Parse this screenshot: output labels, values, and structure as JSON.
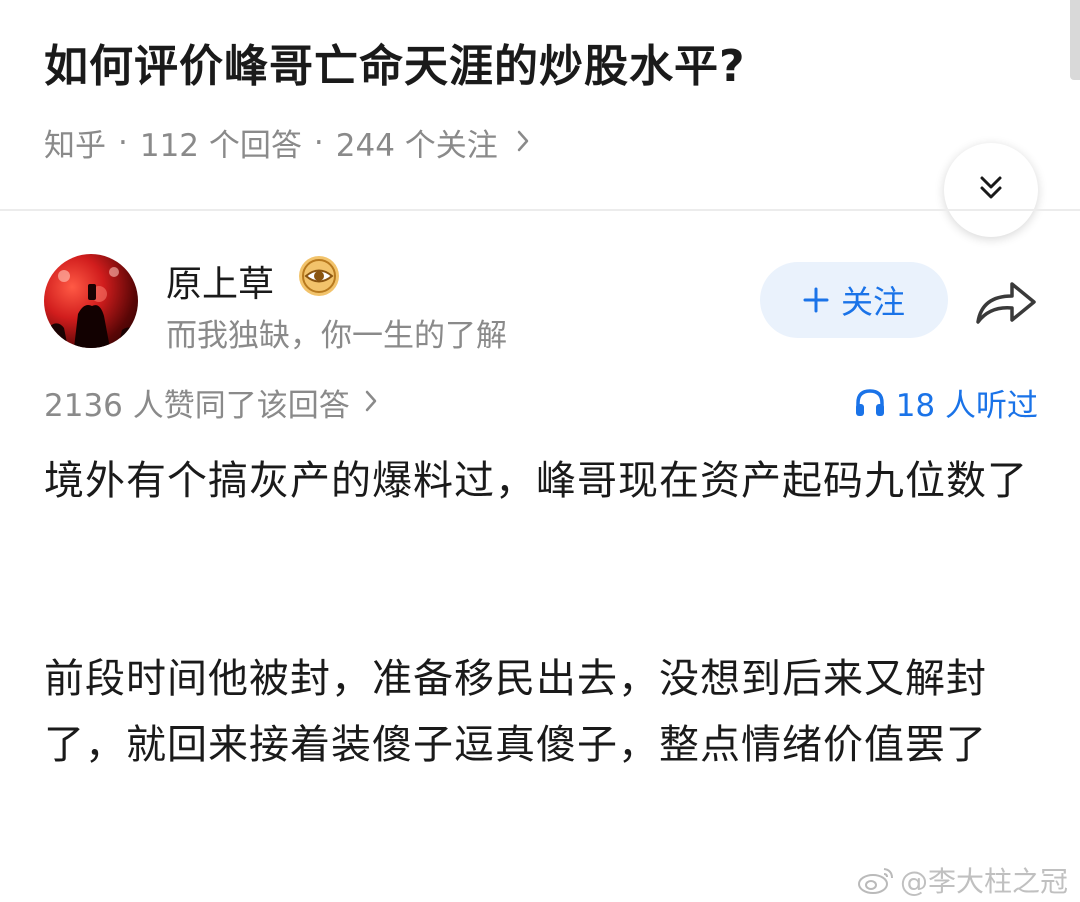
{
  "question": {
    "title": "如何评价峰哥亡命天涯的炒股水平?",
    "source": "知乎",
    "answers": "112 个回答",
    "followers": "244 个关注"
  },
  "author": {
    "name": "原上草",
    "bio": "而我独缺，你一生的了解",
    "follow_label": "关注"
  },
  "stats": {
    "likes": "2136 人赞同了该回答",
    "listens": "18 人听过"
  },
  "content": {
    "paragraph_1": "境外有个搞灰产的爆料过，峰哥现在资产起码九位数了",
    "paragraph_2": "前段时间他被封，准备移民出去，没想到后来又解封了，就回来接着装傻子逗真傻子，整点情绪价值罢了"
  },
  "watermark": "@李大柱之冠",
  "colors": {
    "accent": "#1a73e8",
    "muted": "#8a8a8a",
    "follow_bg": "#eaf2fc"
  },
  "icons": [
    "chevron-right-icon",
    "double-chevron-down-icon",
    "verified-badge-icon",
    "plus-icon",
    "share-icon",
    "headphones-icon",
    "weibo-icon"
  ]
}
